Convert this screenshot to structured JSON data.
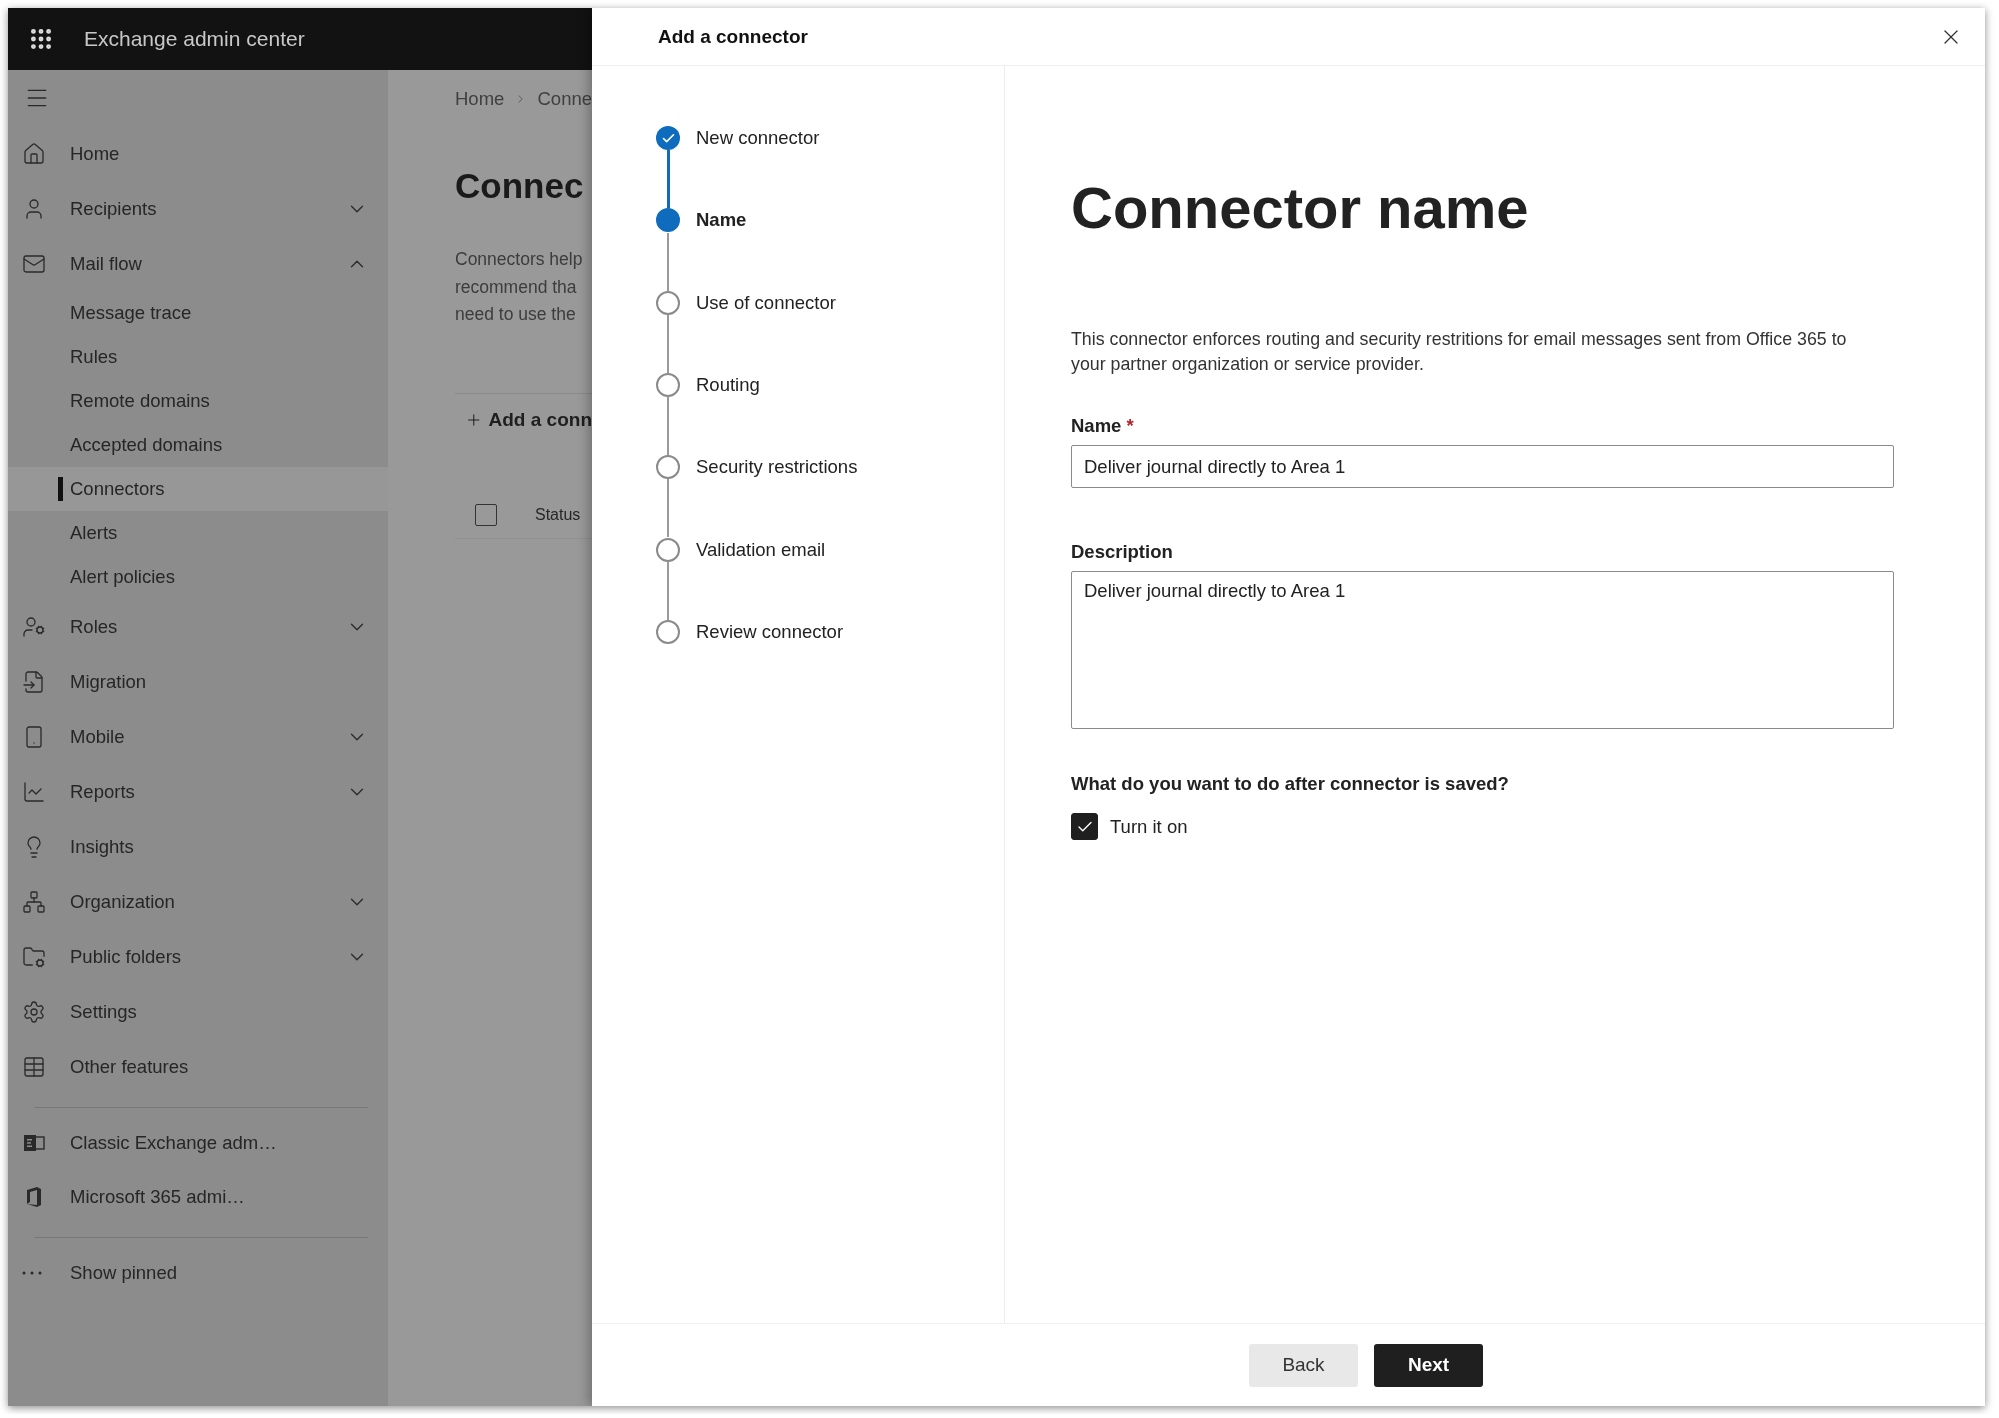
{
  "app": {
    "title": "Exchange admin center"
  },
  "sidebar": {
    "items": [
      {
        "label": "Home",
        "selected": false
      },
      {
        "label": "Recipients",
        "selected": false,
        "expanded": false
      },
      {
        "label": "Mail flow",
        "selected": false,
        "expanded": true,
        "children": [
          {
            "label": "Message trace",
            "selected": false
          },
          {
            "label": "Rules",
            "selected": false
          },
          {
            "label": "Remote domains",
            "selected": false
          },
          {
            "label": "Accepted domains",
            "selected": false
          },
          {
            "label": "Connectors",
            "selected": true
          },
          {
            "label": "Alerts",
            "selected": false
          },
          {
            "label": "Alert policies",
            "selected": false
          }
        ]
      },
      {
        "label": "Roles",
        "selected": false,
        "expanded": false
      },
      {
        "label": "Migration",
        "selected": false
      },
      {
        "label": "Mobile",
        "selected": false,
        "expanded": false
      },
      {
        "label": "Reports",
        "selected": false,
        "expanded": false
      },
      {
        "label": "Insights",
        "selected": false
      },
      {
        "label": "Organization",
        "selected": false,
        "expanded": false
      },
      {
        "label": "Public folders",
        "selected": false,
        "expanded": false
      },
      {
        "label": "Settings",
        "selected": false
      },
      {
        "label": "Other features",
        "selected": false
      }
    ],
    "links": [
      {
        "label": "Classic Exchange adm…",
        "selected": false
      },
      {
        "label": "Microsoft 365 admi…",
        "selected": false
      }
    ],
    "show_pinned": "Show pinned"
  },
  "main": {
    "breadcrumb": [
      "Home",
      "Conne"
    ],
    "heading": "Connec",
    "description": [
      "Connectors help",
      "recommend tha",
      "need to use the"
    ],
    "add_label": "Add a conn",
    "table": {
      "select_all_checked": false,
      "columns": [
        "Status"
      ]
    }
  },
  "panel": {
    "title": "Add a connector",
    "steps": [
      {
        "label": "New connector",
        "completed": true,
        "selected": false
      },
      {
        "label": "Name",
        "completed": false,
        "selected": true
      },
      {
        "label": "Use of connector",
        "completed": false,
        "selected": false
      },
      {
        "label": "Routing",
        "completed": false,
        "selected": false
      },
      {
        "label": "Security restrictions",
        "completed": false,
        "selected": false
      },
      {
        "label": "Validation email",
        "completed": false,
        "selected": false
      },
      {
        "label": "Review connector",
        "completed": false,
        "selected": false
      }
    ],
    "form": {
      "heading": "Connector name",
      "intro": "This connector enforces routing and security restritions for email messages sent from Office 365 to your partner organization or service provider.",
      "name": {
        "label": "Name",
        "required_mark": "*",
        "value": "Deliver journal directly to Area 1"
      },
      "description": {
        "label": "Description",
        "value": "Deliver journal directly to Area 1"
      },
      "question": "What do you want to do after connector is saved?",
      "turn_on": {
        "label": "Turn it on",
        "checked": true
      }
    },
    "buttons": [
      {
        "label": "Back",
        "kind": "secondary"
      },
      {
        "label": "Next",
        "kind": "primary"
      }
    ]
  }
}
